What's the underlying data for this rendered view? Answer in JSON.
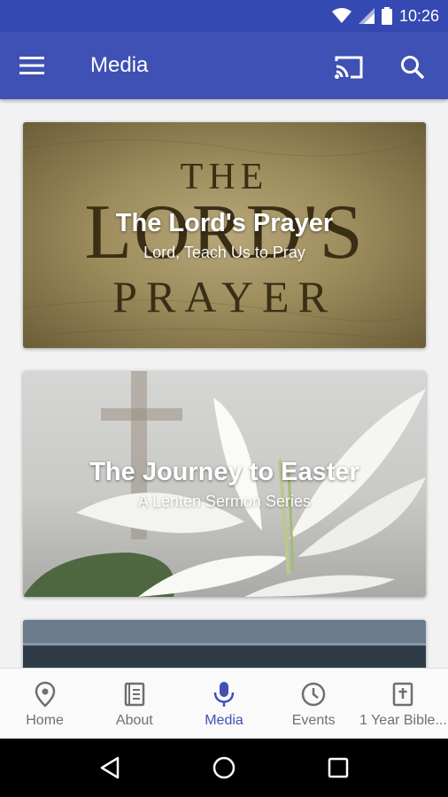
{
  "status_bar": {
    "time": "10:26"
  },
  "app_bar": {
    "title": "Media",
    "icons": [
      "menu-icon",
      "cast-icon",
      "search-icon"
    ]
  },
  "media": {
    "items": [
      {
        "title": "The Lord's Prayer",
        "subtitle": "Lord, Teach Us to Pray",
        "art_text": [
          "THE",
          "LORD'S",
          "PRAYER"
        ]
      },
      {
        "title": "The Journey to Easter",
        "subtitle": "A Lenten Sermon Series"
      },
      {
        "title": "",
        "subtitle": ""
      }
    ]
  },
  "bottom_nav": {
    "items": [
      {
        "label": "Home",
        "icon": "map-pin-icon"
      },
      {
        "label": "About",
        "icon": "book-icon"
      },
      {
        "label": "Media",
        "icon": "microphone-icon",
        "active": true
      },
      {
        "label": "Events",
        "icon": "clock-icon"
      },
      {
        "label": "1 Year Bible...",
        "icon": "bible-icon"
      }
    ]
  },
  "colors": {
    "primary": "#3f51b5",
    "status_bar": "#3549b2",
    "inactive": "#6f6f6f"
  }
}
